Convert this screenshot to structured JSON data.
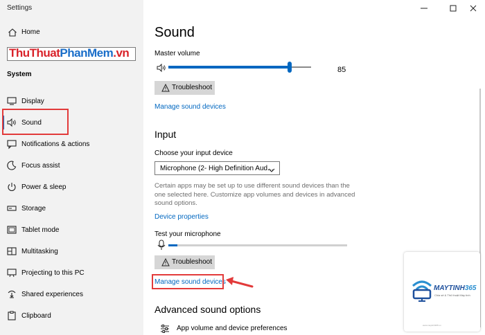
{
  "window": {
    "title": "Settings"
  },
  "sidebar": {
    "home_label": "Home",
    "watermark": {
      "part1": "ThuThuat",
      "part2": "PhanMem",
      "part3": ".vn"
    },
    "section_title": "System",
    "items": [
      {
        "label": "Display",
        "icon": "display-icon"
      },
      {
        "label": "Sound",
        "icon": "speaker-icon",
        "active": true
      },
      {
        "label": "Notifications & actions",
        "icon": "notifications-icon"
      },
      {
        "label": "Focus assist",
        "icon": "moon-icon"
      },
      {
        "label": "Power & sleep",
        "icon": "power-icon"
      },
      {
        "label": "Storage",
        "icon": "storage-icon"
      },
      {
        "label": "Tablet mode",
        "icon": "tablet-icon"
      },
      {
        "label": "Multitasking",
        "icon": "multitasking-icon"
      },
      {
        "label": "Projecting to this PC",
        "icon": "projecting-icon"
      },
      {
        "label": "Shared experiences",
        "icon": "shared-icon"
      },
      {
        "label": "Clipboard",
        "icon": "clipboard-icon"
      }
    ]
  },
  "main": {
    "title": "Sound",
    "master_volume": {
      "label": "Master volume",
      "value": "85",
      "level": 0.85
    },
    "troubleshoot_label": "Troubleshoot",
    "manage_devices_link": "Manage sound devices",
    "input": {
      "heading": "Input",
      "choose_label": "Choose your input device",
      "selected_device": "Microphone (2- High Definition Aud...",
      "description": "Certain apps may be set up to use different sound devices than the one selected here. Customize app volumes and devices in advanced sound options.",
      "device_properties_link": "Device properties",
      "test_label": "Test your microphone",
      "mic_level": 0.05,
      "troubleshoot_label": "Troubleshoot",
      "manage_devices_link": "Manage sound devices"
    },
    "advanced": {
      "heading": "Advanced sound options",
      "app_volume_label": "App volume and device preferences"
    }
  },
  "logo": {
    "name_part1": "MAYTINH",
    "name_part2": "365",
    "tagline": "Chia sẻ & Thủ thuật Máy tính",
    "url": "www.maytinh365.vn"
  },
  "colors": {
    "accent": "#0067c0",
    "annotation": "#e23a3a",
    "sidebar_bg": "#f2f2f2"
  }
}
